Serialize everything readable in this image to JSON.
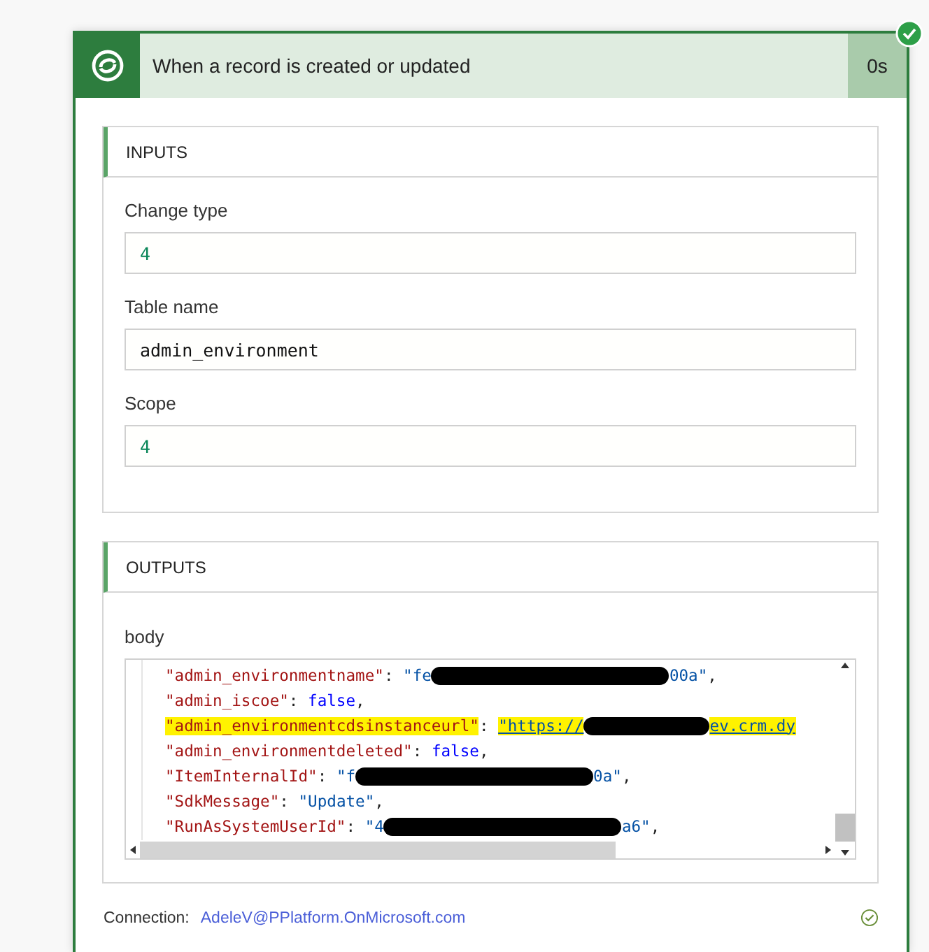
{
  "trigger": {
    "title": "When a record is created or updated",
    "duration": "0s",
    "succeeded": true
  },
  "inputs": {
    "heading": "INPUTS",
    "fields": [
      {
        "label": "Change type",
        "value": "4",
        "kind": "number"
      },
      {
        "label": "Table name",
        "value": "admin_environment",
        "kind": "text"
      },
      {
        "label": "Scope",
        "value": "4",
        "kind": "number"
      }
    ]
  },
  "outputs": {
    "heading": "OUTPUTS",
    "label": "body",
    "lines": [
      {
        "highlighted": false,
        "tokens": [
          {
            "kind": "key",
            "text": "\"admin_environmentname\""
          },
          {
            "kind": "punct",
            "text": ": "
          },
          {
            "kind": "string",
            "text": "\"fe"
          },
          {
            "kind": "redaction"
          },
          {
            "kind": "string",
            "text": "00a\""
          },
          {
            "kind": "punct",
            "text": ","
          }
        ]
      },
      {
        "highlighted": false,
        "tokens": [
          {
            "kind": "key",
            "text": "\"admin_iscoe\""
          },
          {
            "kind": "punct",
            "text": ": "
          },
          {
            "kind": "bool",
            "text": "false"
          },
          {
            "kind": "punct",
            "text": ","
          }
        ]
      },
      {
        "highlighted": true,
        "tokens": [
          {
            "kind": "key",
            "text": "\"admin_environmentcdsinstanceurl\""
          },
          {
            "kind": "punct",
            "text": ": "
          },
          {
            "kind": "link",
            "text": "\"https://"
          },
          {
            "kind": "redaction"
          },
          {
            "kind": "link",
            "text": "ev.crm.dy"
          }
        ]
      },
      {
        "highlighted": false,
        "tokens": [
          {
            "kind": "key",
            "text": "\"admin_environmentdeleted\""
          },
          {
            "kind": "punct",
            "text": ": "
          },
          {
            "kind": "bool",
            "text": "false"
          },
          {
            "kind": "punct",
            "text": ","
          }
        ]
      },
      {
        "highlighted": false,
        "tokens": [
          {
            "kind": "key",
            "text": "\"ItemInternalId\""
          },
          {
            "kind": "punct",
            "text": ": "
          },
          {
            "kind": "string",
            "text": "\"f"
          },
          {
            "kind": "redaction"
          },
          {
            "kind": "string",
            "text": "0a\""
          },
          {
            "kind": "punct",
            "text": ","
          }
        ]
      },
      {
        "highlighted": false,
        "tokens": [
          {
            "kind": "key",
            "text": "\"SdkMessage\""
          },
          {
            "kind": "punct",
            "text": ": "
          },
          {
            "kind": "string",
            "text": "\"Update\""
          },
          {
            "kind": "punct",
            "text": ","
          }
        ]
      },
      {
        "highlighted": false,
        "tokens": [
          {
            "kind": "key",
            "text": "\"RunAsSystemUserId\""
          },
          {
            "kind": "punct",
            "text": ": "
          },
          {
            "kind": "string",
            "text": "\"4"
          },
          {
            "kind": "redaction"
          },
          {
            "kind": "string",
            "text": "a6\""
          },
          {
            "kind": "punct",
            "text": ","
          }
        ]
      }
    ]
  },
  "connection": {
    "label": "Connection:",
    "account": "AdeleV@PPlatform.OnMicrosoft.com",
    "verified": true
  }
}
